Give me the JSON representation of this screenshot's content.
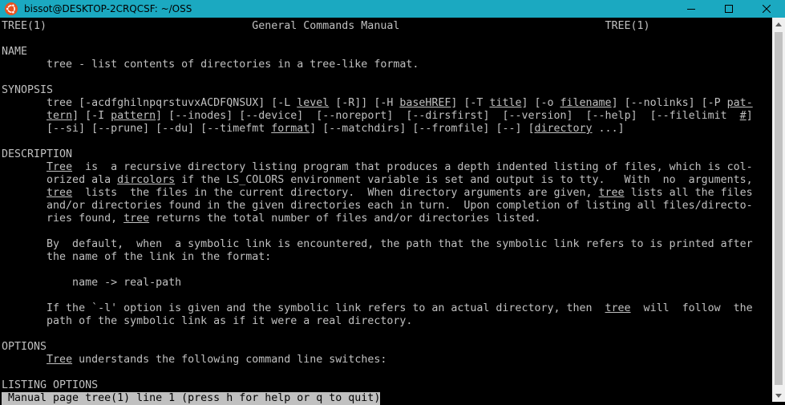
{
  "window": {
    "title": "bissot@DESKTOP-2CRQCSF: ~/OSS",
    "icon": "ubuntu-icon",
    "controls": [
      "minimize-icon",
      "maximize-icon",
      "close-icon"
    ],
    "titlebar_color": "#1ba9c1"
  },
  "terminal": {
    "fg": "#c0c0c0",
    "bg": "#000000",
    "lines": [
      [
        {
          "t": "TREE(1)                                General Commands Manual                                TREE(1)"
        }
      ],
      [
        {
          "t": ""
        }
      ],
      [
        {
          "t": "NAME"
        }
      ],
      [
        {
          "t": "       tree - list contents of directories in a tree-like format."
        }
      ],
      [
        {
          "t": ""
        }
      ],
      [
        {
          "t": "SYNOPSIS"
        }
      ],
      [
        {
          "t": "       tree [-acdfghilnpqrstuvxACDFQNSUX] [-L "
        },
        {
          "t": "level",
          "u": true
        },
        {
          "t": " [-R]] [-H "
        },
        {
          "t": "baseHREF",
          "u": true
        },
        {
          "t": "] [-T "
        },
        {
          "t": "title",
          "u": true
        },
        {
          "t": "] [-o "
        },
        {
          "t": "filename",
          "u": true
        },
        {
          "t": "] [--nolinks] [-P "
        },
        {
          "t": "pat-",
          "u": true
        }
      ],
      [
        {
          "t": "       "
        },
        {
          "t": "tern",
          "u": true
        },
        {
          "t": "] [-I "
        },
        {
          "t": "pattern",
          "u": true
        },
        {
          "t": "] [--inodes] [--device]  [--noreport]  [--dirsfirst]  [--version]  [--help]  [--filelimit  "
        },
        {
          "t": "#",
          "u": true
        },
        {
          "t": "]"
        }
      ],
      [
        {
          "t": "       [--si] [--prune] [--du] [--timefmt "
        },
        {
          "t": "format",
          "u": true
        },
        {
          "t": "] [--matchdirs] [--fromfile] [--] ["
        },
        {
          "t": "directory",
          "u": true
        },
        {
          "t": " ...]"
        }
      ],
      [
        {
          "t": ""
        }
      ],
      [
        {
          "t": "DESCRIPTION"
        }
      ],
      [
        {
          "t": "       "
        },
        {
          "t": "Tree",
          "u": true
        },
        {
          "t": "  is  a recursive directory listing program that produces a depth indented listing of files, which is col-"
        }
      ],
      [
        {
          "t": "       orized ala "
        },
        {
          "t": "dircolors",
          "u": true
        },
        {
          "t": " if the LS_COLORS environment variable is set and output is to tty.   With  no  arguments,"
        }
      ],
      [
        {
          "t": "       "
        },
        {
          "t": "tree",
          "u": true
        },
        {
          "t": "  lists  the files in the current directory.  When directory arguments are given, "
        },
        {
          "t": "tree",
          "u": true
        },
        {
          "t": " lists all the files"
        }
      ],
      [
        {
          "t": "       and/or directories found in the given directories each in turn.  Upon completion of listing all files/directo-"
        }
      ],
      [
        {
          "t": "       ries found, "
        },
        {
          "t": "tree",
          "u": true
        },
        {
          "t": " returns the total number of files and/or directories listed."
        }
      ],
      [
        {
          "t": ""
        }
      ],
      [
        {
          "t": "       By  default,  when  a symbolic link is encountered, the path that the symbolic link refers to is printed after"
        }
      ],
      [
        {
          "t": "       the name of the link in the format:"
        }
      ],
      [
        {
          "t": ""
        }
      ],
      [
        {
          "t": "           name -> real-path"
        }
      ],
      [
        {
          "t": ""
        }
      ],
      [
        {
          "t": "       If the `-l' option is given and the symbolic link refers to an actual directory, then  "
        },
        {
          "t": "tree",
          "u": true
        },
        {
          "t": "  will  follow  the"
        }
      ],
      [
        {
          "t": "       path of the symbolic link as if it were a real directory."
        }
      ],
      [
        {
          "t": ""
        }
      ],
      [
        {
          "t": "OPTIONS"
        }
      ],
      [
        {
          "t": "       "
        },
        {
          "t": "Tree",
          "u": true
        },
        {
          "t": " understands the following command line switches:"
        }
      ],
      [
        {
          "t": ""
        }
      ],
      [
        {
          "t": "LISTING OPTIONS"
        }
      ]
    ],
    "status": " Manual page tree(1) line 1 (press h for help or q to quit)"
  }
}
